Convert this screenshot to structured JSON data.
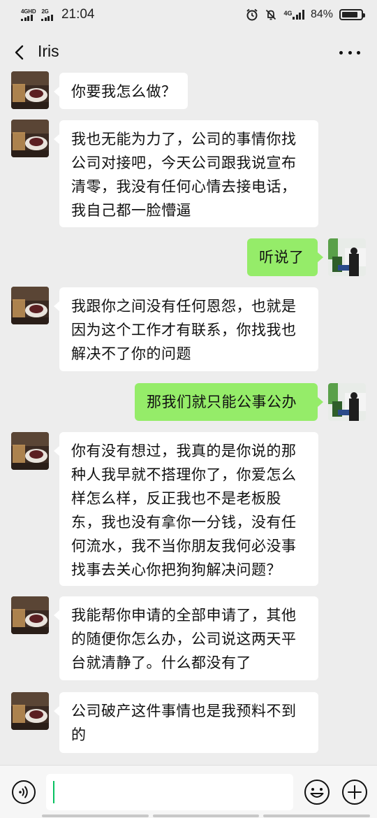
{
  "status_bar": {
    "net1": "4GHD",
    "net2": "2G",
    "time": "21:04",
    "lte": "4G",
    "battery_text": "84%",
    "battery_level": 0.84
  },
  "header": {
    "title": "Iris"
  },
  "messages": [
    {
      "side": "left",
      "text": "你要我怎么做？"
    },
    {
      "side": "left",
      "text": "我也无能为力了，公司的事情你找公司对接吧，今天公司跟我说宣布清零，我没有任何心情去接电话，我自己都一脸懵逼"
    },
    {
      "side": "right",
      "text": "听说了"
    },
    {
      "side": "left",
      "text": "我跟你之间没有任何恩怨，也就是因为这个工作才有联系，你找我也解决不了你的问题"
    },
    {
      "side": "right",
      "text": "那我们就只能公事公办"
    },
    {
      "side": "left",
      "text": "你有没有想过，我真的是你说的那种人我早就不搭理你了，你爱怎么样怎么样，反正我也不是老板股东，我也没有拿你一分钱，没有任何流水，我不当你朋友我何必没事找事去关心你把狗狗解决问题？"
    },
    {
      "side": "left",
      "text": "我能帮你申请的全部申请了，其他的随便你怎么办，公司说这两天平台就清静了。什么都没有了"
    },
    {
      "side": "left",
      "text": "公司破产这件事情也是我预料不到的"
    }
  ],
  "input": {
    "value": ""
  },
  "colors": {
    "background": "#ededed",
    "bubble_left": "#ffffff",
    "bubble_right": "#95ec69",
    "caret": "#07c160"
  }
}
